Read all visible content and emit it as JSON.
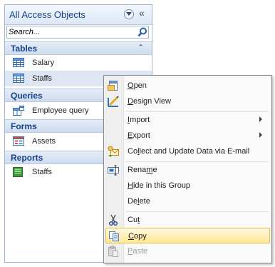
{
  "nav": {
    "title": "All Access Objects",
    "search_placeholder": "Search...",
    "groups": [
      {
        "label": "Tables",
        "items": [
          {
            "label": "Salary"
          },
          {
            "label": "Staffs"
          }
        ]
      },
      {
        "label": "Queries",
        "items": [
          {
            "label": "Employee query"
          }
        ]
      },
      {
        "label": "Forms",
        "items": [
          {
            "label": "Assets"
          }
        ]
      },
      {
        "label": "Reports",
        "items": [
          {
            "label": "Staffs"
          }
        ]
      }
    ]
  },
  "menu": {
    "open": {
      "before": "",
      "key": "O",
      "after": "pen"
    },
    "design_view": {
      "before": "",
      "key": "D",
      "after": "esign View"
    },
    "import": {
      "before": "",
      "key": "I",
      "after": "mport"
    },
    "export": {
      "before": "",
      "key": "E",
      "after": "xport"
    },
    "collect": {
      "before": "Co",
      "key": "l",
      "after": "lect and Update Data via E-mail"
    },
    "rename": {
      "before": "Rena",
      "key": "m",
      "after": "e"
    },
    "hide": {
      "before": "",
      "key": "H",
      "after": "ide in this Group"
    },
    "delete": {
      "before": "De",
      "key": "l",
      "after": "ete"
    },
    "cut": {
      "before": "Cu",
      "key": "t",
      "after": ""
    },
    "copy": {
      "before": "",
      "key": "C",
      "after": "opy"
    },
    "paste": {
      "before": "",
      "key": "P",
      "after": "aste"
    }
  }
}
